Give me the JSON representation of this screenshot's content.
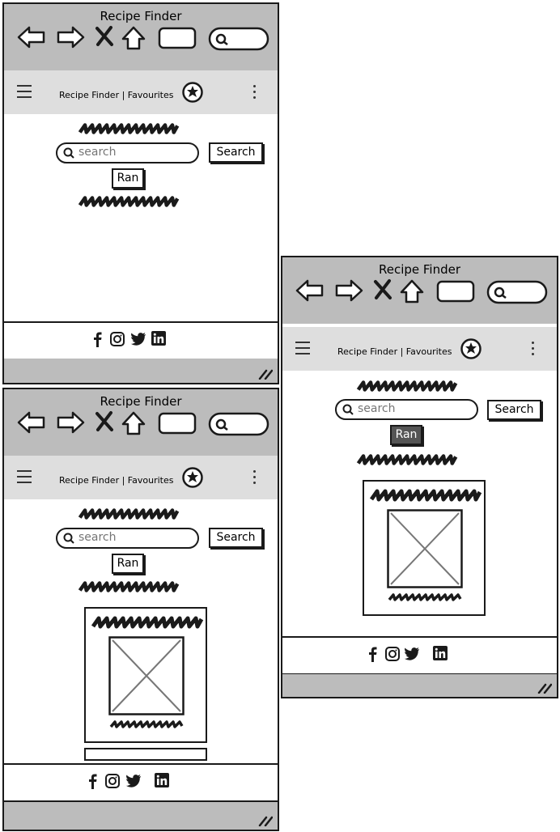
{
  "window": {
    "title": "Recipe Finder"
  },
  "appbar": {
    "title": "Recipe Finder | Favourites"
  },
  "search": {
    "placeholder": "search",
    "button_label": "Search"
  },
  "random": {
    "label": "Ran"
  },
  "social": [
    "facebook-icon",
    "instagram-icon",
    "twitter-icon",
    "linkedin-icon"
  ],
  "colors": {
    "titlebar": "#bcbcbc",
    "appbar": "#dedede",
    "ink": "#1a1a1a",
    "random_pressed": "#555555"
  }
}
